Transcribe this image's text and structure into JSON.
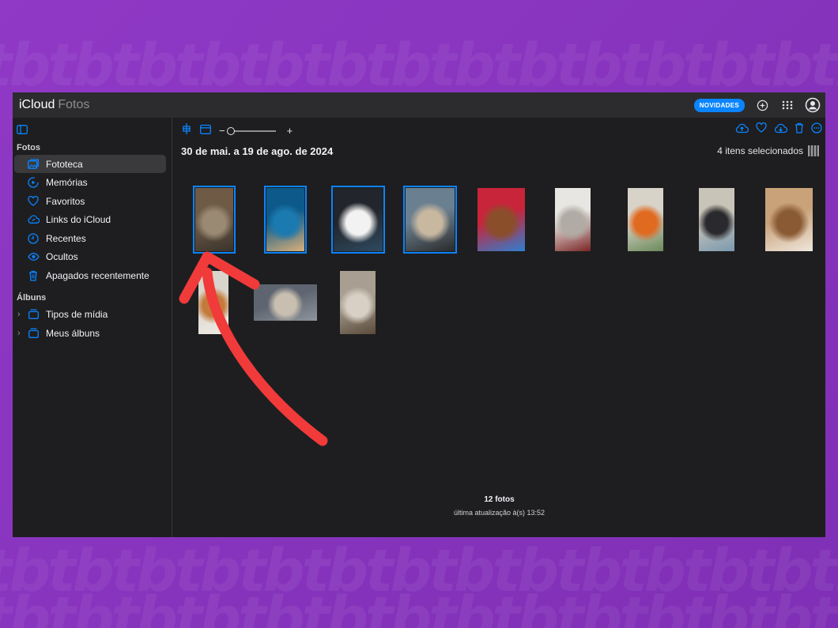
{
  "app": {
    "apple_glyph": "",
    "brand": "iCloud",
    "section": "Fotos"
  },
  "header": {
    "news_badge": "NOVIDADES",
    "icons": [
      "add-icon",
      "apps-grid-icon",
      "account-icon"
    ]
  },
  "sidebar": {
    "section_photos": "Fotos",
    "section_albums": "Álbuns",
    "items": [
      {
        "label": "Fototeca",
        "icon": "library-icon",
        "active": true
      },
      {
        "label": "Memórias",
        "icon": "memories-icon"
      },
      {
        "label": "Favoritos",
        "icon": "heart-icon"
      },
      {
        "label": "Links do iCloud",
        "icon": "cloud-link-icon"
      },
      {
        "label": "Recentes",
        "icon": "clock-icon"
      },
      {
        "label": "Ocultos",
        "icon": "eye-icon"
      },
      {
        "label": "Apagados recentemente",
        "icon": "trash-icon"
      }
    ],
    "albums": [
      {
        "label": "Tipos de mídia",
        "icon": "folder-icon"
      },
      {
        "label": "Meus álbuns",
        "icon": "folder-icon"
      }
    ]
  },
  "toolbar": {
    "zoom_minus": "−",
    "zoom_plus": "+",
    "right_icons": [
      "upload-icon",
      "heart-icon",
      "download-icon",
      "trash-icon",
      "more-icon"
    ]
  },
  "main": {
    "date_range": "30 de mai. a 19 de ago. de 2024",
    "selection_info": "4 itens selecionados",
    "photos_count": "12 fotos",
    "last_update": "última atualização à(s) 13:52"
  },
  "photos": [
    {
      "name": "photo-books-shelf",
      "selected": true,
      "colors": [
        "#6e5a45",
        "#9a8a74",
        "#3a332c"
      ]
    },
    {
      "name": "photo-cat-blue-blanket",
      "selected": true,
      "colors": [
        "#0d5a8a",
        "#1b7ab0",
        "#d9b07a"
      ]
    },
    {
      "name": "photo-cat-closeup",
      "selected": true,
      "colors": [
        "#22252b",
        "#f2f2f2",
        "#2e4a60"
      ]
    },
    {
      "name": "photo-cat-siamese",
      "selected": true,
      "colors": [
        "#6a7f8f",
        "#c9b8a0",
        "#2a2a2a"
      ]
    },
    {
      "name": "photo-cat-colorful",
      "selected": false,
      "colors": [
        "#c8243a",
        "#8a4f2a",
        "#2f7fd0"
      ]
    },
    {
      "name": "photo-kitchen-cat",
      "selected": false,
      "colors": [
        "#e8e6e2",
        "#b0aba4",
        "#7a2525"
      ]
    },
    {
      "name": "photo-vinyl-records",
      "selected": false,
      "colors": [
        "#d8d3c9",
        "#e06a20",
        "#6b8a5a"
      ]
    },
    {
      "name": "photo-cat-bed",
      "selected": false,
      "colors": [
        "#c9c4b8",
        "#2a2a2e",
        "#7b9ab0"
      ]
    },
    {
      "name": "photo-cat-box",
      "selected": false,
      "colors": [
        "#c9a27a",
        "#8a5a35",
        "#efe7dc"
      ]
    },
    {
      "name": "photo-cat-wall",
      "selected": false,
      "colors": [
        "#d9d4cc",
        "#c47a3a",
        "#f0ece6"
      ]
    },
    {
      "name": "photo-cat-sofa",
      "selected": false,
      "colors": [
        "#5e6570",
        "#c9bfb0",
        "#8f959e"
      ]
    },
    {
      "name": "photo-cat-floor",
      "selected": false,
      "colors": [
        "#a89f92",
        "#d8d0c5",
        "#5a4a3a"
      ]
    }
  ]
}
